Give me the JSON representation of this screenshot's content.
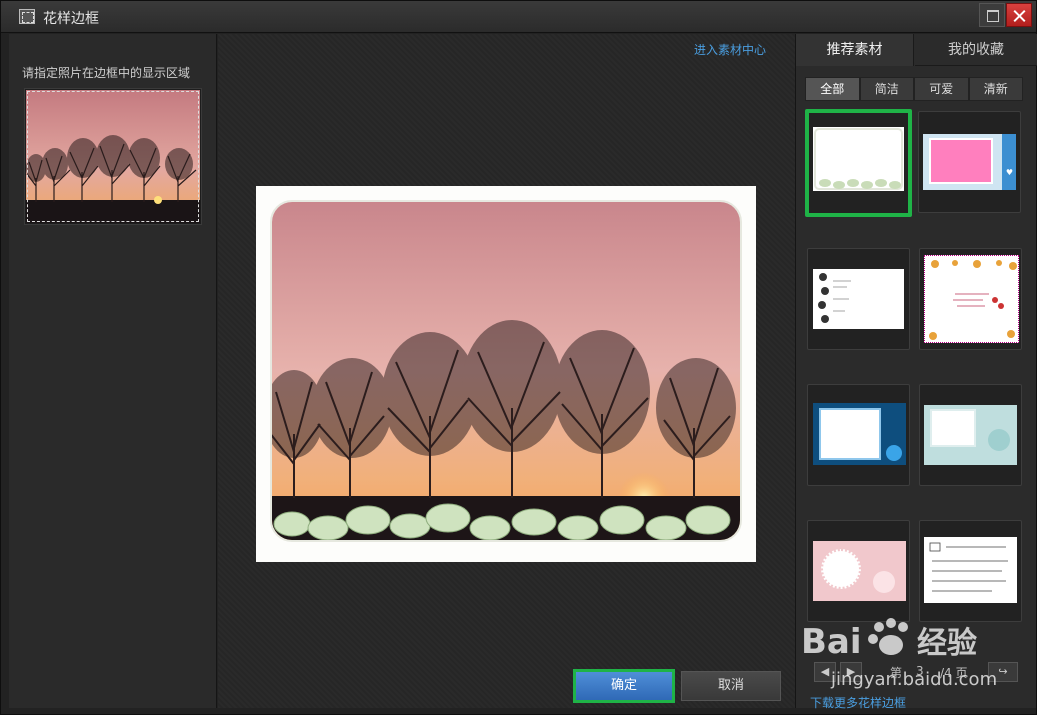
{
  "window": {
    "title": "花样边框"
  },
  "left": {
    "hint": "请指定照片在边框中的显示区域"
  },
  "center": {
    "material_link": "进入素材中心",
    "confirm_label": "确定",
    "cancel_label": "取消"
  },
  "right": {
    "tabs": [
      {
        "label": "推荐素材",
        "active": true
      },
      {
        "label": "我的收藏",
        "active": false
      }
    ],
    "filters": [
      {
        "label": "全部",
        "active": true
      },
      {
        "label": "简洁"
      },
      {
        "label": "可爱"
      },
      {
        "label": "清新"
      }
    ],
    "pager": {
      "prefix": "第",
      "current": "3",
      "total_text": "/4 页"
    },
    "more_link": "下载更多花样边框"
  },
  "watermark": {
    "text": "Baidu经验",
    "url": "jingyan.baidu.com"
  },
  "colors": {
    "accent_green": "#1fb347",
    "link_blue": "#4a9ee0",
    "confirm_blue": "#3a78c6"
  }
}
